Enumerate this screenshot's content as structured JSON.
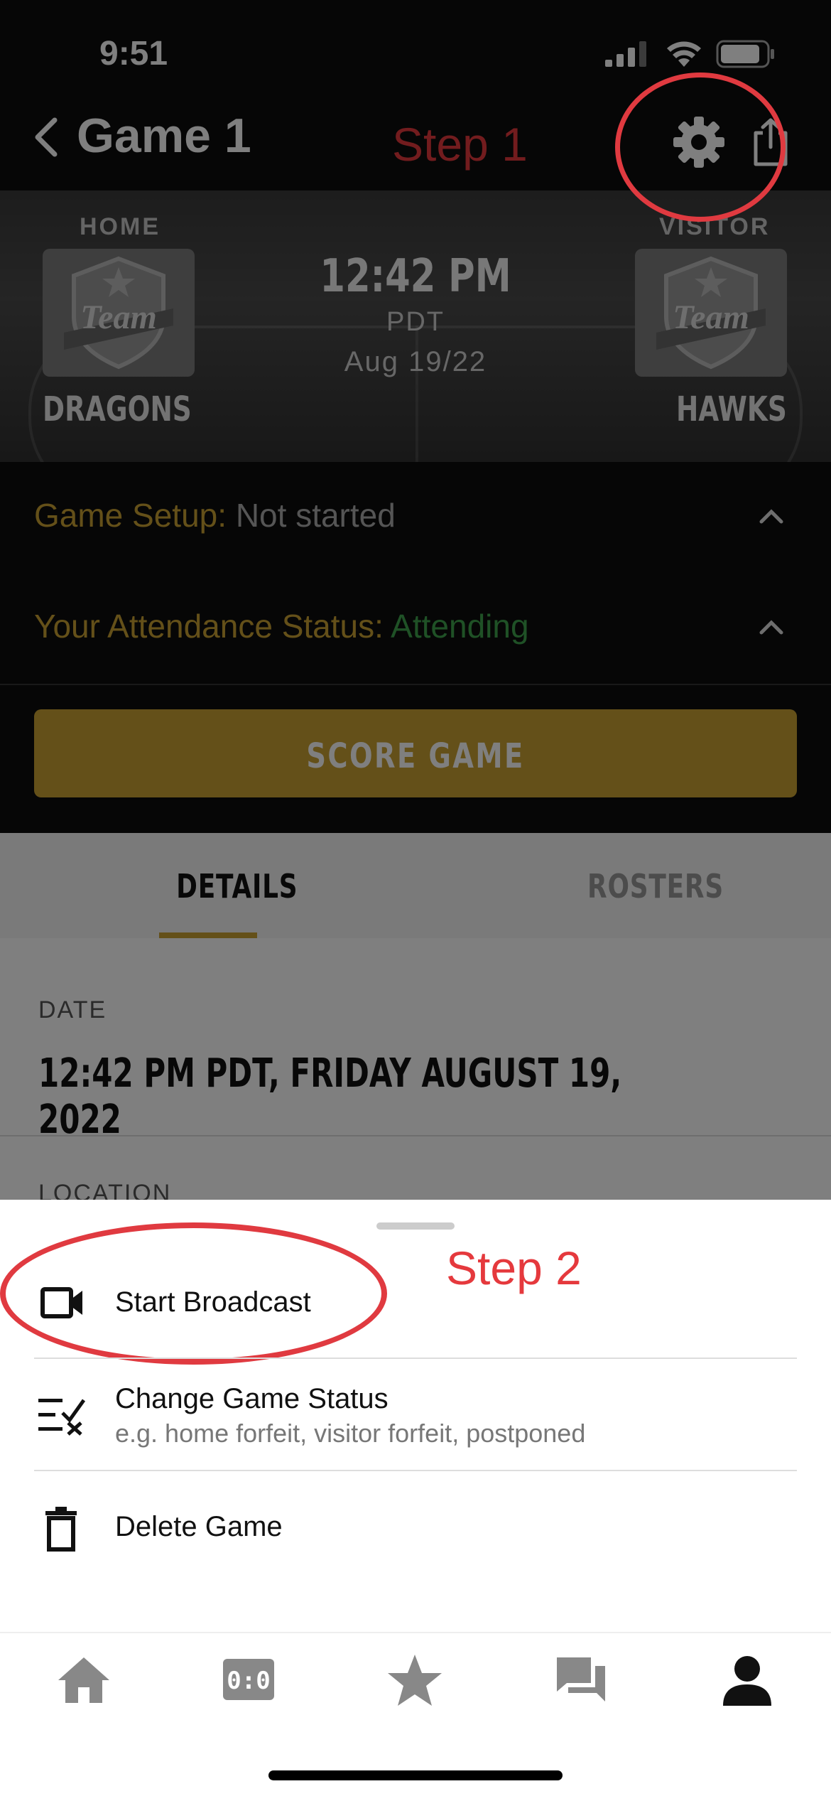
{
  "status_bar": {
    "time": "9:51"
  },
  "header": {
    "title": "Game 1",
    "annotation": "Step 1"
  },
  "banner": {
    "home_label": "HOME",
    "visitor_label": "VISITOR",
    "home_team": "DRAGONS",
    "visitor_team": "HAWKS",
    "time": "12:42 PM",
    "timezone": "PDT",
    "date": "Aug 19/22",
    "logo_text": "Team"
  },
  "game_setup": {
    "label": "Game Setup:",
    "value": "Not started"
  },
  "attendance": {
    "label": "Your Attendance Status:",
    "value": "Attending"
  },
  "score_button": {
    "label": "SCORE GAME"
  },
  "tabs": [
    {
      "label": "DETAILS",
      "active": true
    },
    {
      "label": "ROSTERS",
      "active": false
    }
  ],
  "details": {
    "date_label": "DATE",
    "date_value": "12:42 PM PDT, FRIDAY AUGUST 19, 2022",
    "location_label": "LOCATION"
  },
  "sheet": {
    "annotation": "Step 2",
    "items": [
      {
        "label": "Start Broadcast",
        "icon": "video-camera-icon"
      },
      {
        "label": "Change Game Status",
        "sub": "e.g. home forfeit, visitor forfeit, postponed",
        "icon": "list-check-icon"
      },
      {
        "label": "Delete Game",
        "icon": "trash-icon"
      }
    ]
  },
  "bottom_nav": [
    "home-icon",
    "scoreboard-icon",
    "star-icon",
    "chat-icon",
    "profile-icon"
  ],
  "colors": {
    "accent": "#c8a032",
    "annotation": "#e5393d",
    "attending": "#3fa34d",
    "setup_label": "#c8a032"
  }
}
